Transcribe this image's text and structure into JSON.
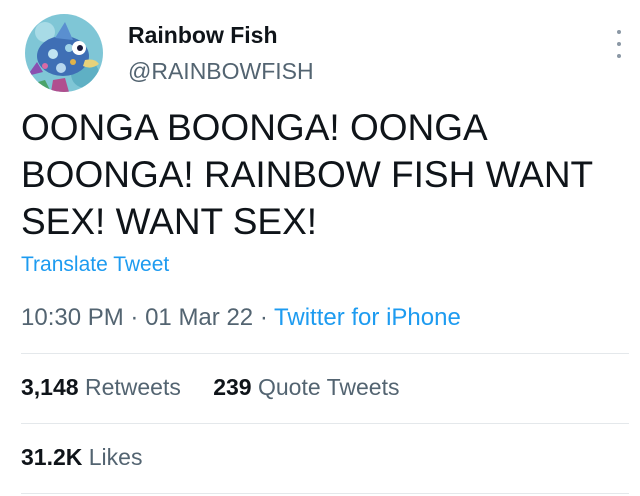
{
  "user": {
    "display_name": "Rainbow Fish",
    "handle": "@RAINBOWFISH",
    "avatar_icon": "rainbow-fish-avatar"
  },
  "more_icon": "vertical-ellipsis-icon",
  "tweet": {
    "text": "OONGA BOONGA! OONGA BOONGA! RAINBOW FISH WANT SEX! WANT SEX!",
    "translate_label": "Translate Tweet"
  },
  "meta": {
    "time": "10:30 PM",
    "separator": "·",
    "date": "01 Mar 22",
    "source": "Twitter for iPhone"
  },
  "stats": {
    "retweets_count": "3,148",
    "retweets_label": "Retweets",
    "quotes_count": "239",
    "quotes_label": "Quote Tweets",
    "likes_count": "31.2K",
    "likes_label": "Likes"
  },
  "colors": {
    "accent": "#1d9bf0",
    "secondary_text": "#536471",
    "primary_text": "#0f1419",
    "divider": "#e4e8eb"
  }
}
